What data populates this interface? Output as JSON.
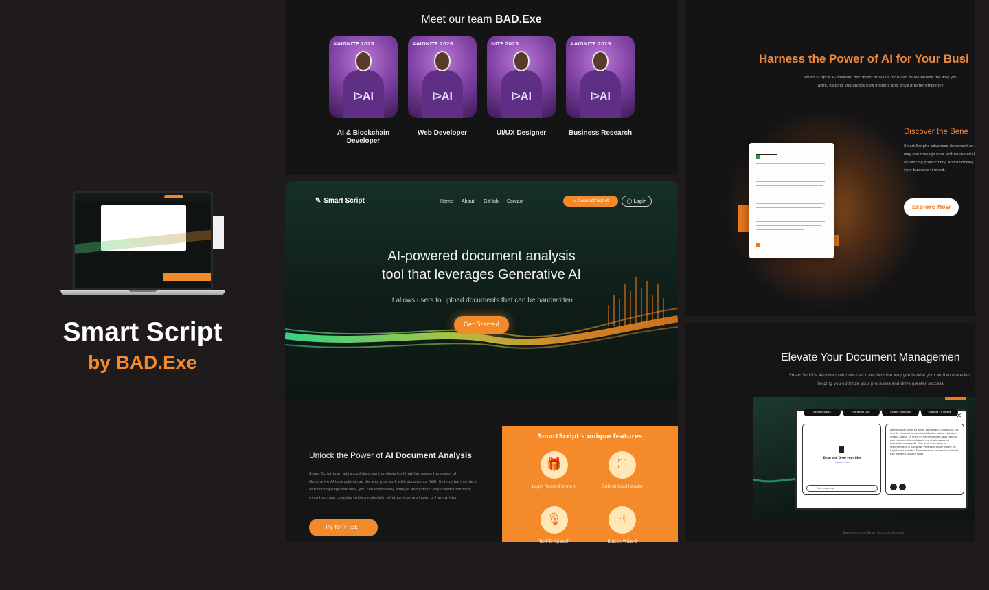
{
  "brand": {
    "title": "Smart Script",
    "by_prefix": "by ",
    "by_name": "BAD.Exe"
  },
  "team": {
    "heading_prefix": "Meet our team ",
    "heading_bold": "BAD.Exe",
    "members": [
      {
        "role": "AI & Blockchain Developer",
        "shirt_text": "I>AI",
        "tag": "#AIGNITE 2025"
      },
      {
        "role": "Web Developer",
        "shirt_text": "I>AI",
        "tag": "#AIGNITE 2025"
      },
      {
        "role": "UI/UX Designer",
        "shirt_text": "I>AI",
        "tag": "NITE 2025"
      },
      {
        "role": "Business Research",
        "shirt_text": "I>AI",
        "tag": "#AIGNITE 2025"
      }
    ]
  },
  "hero": {
    "logo": "Smart Script",
    "nav": [
      "Home",
      "About",
      "GitHub",
      "Contact"
    ],
    "connect_wallet": "Connect Wallet",
    "login": "Login",
    "title_line1": "AI-powered document analysis",
    "title_line2": "tool that leverages Generative AI",
    "subtitle": "It allows users to upload documents that can be handwritten",
    "cta": "Get Started"
  },
  "unlock": {
    "heading_prefix": "Unlock the Power of ",
    "heading_bold": "AI Document Analysis",
    "paragraph": "Smart Script is an advanced document analysis tool that harnesses the power of Generative AI to revolutionize the way you work with documents. With its intuitive interface and cutting-edge features, you can effortlessly analyze and extract key information from even the most complex written materials, whether they are typed or handwritten",
    "cta": "Try for FREE !",
    "features_heading_bold": "SmartScript",
    "features_heading_rest": "'s unique features",
    "features": [
      {
        "label": "Login Reward System",
        "icon": "gift-icon"
      },
      {
        "label": "Optical Card Reader",
        "icon": "scan-icon"
      },
      {
        "label": "Text-To-Speech",
        "icon": "speech-icon"
      },
      {
        "label": "Button Wizard",
        "icon": "pointer-icon"
      }
    ]
  },
  "harness": {
    "heading": "Harness the Power of AI for Your Busi",
    "paragraph": "Smart Script's AI-powered document analysis tools can revolutionize the way you work, helping you unlock new insights and drive greater efficiency",
    "discover_heading": "Discover the Bene",
    "discover_paragraph": "Smart Script's advanced document an... way you manage your written material enhancing productivity, and unlocking your business forward.",
    "cta": "Explore Now"
  },
  "elevate": {
    "heading": "Elevate Your Document Managemen",
    "paragraph": "Smart Script's AI-driven solutions can transform the way you handle your written materials, helping you optimize your processes and drive greater success",
    "upload_title": "Drag and Drop your files",
    "upload_link": "Upload files",
    "prompt_placeholder": "Enter a prompt",
    "result_text": "Lorem ipsum dolor sit amet, consectetur adipiscing elit. Sed do eiusmod tempor incididunt ut labore et dolore magna aliqua. Ut enim ad minim veniam, quis nostrud exercitation ullamco laboris nisi ut aliquip ex ea commodo consequat. Duis aute irure dolor in reprehenderit in voluptate velit esse cillum dolore eu fugiat nulla pariatur. Excepteur sint occaecat cupidatat non proident, sunt in culpa",
    "buttons": [
      "Explore Topics",
      "Generate Que",
      "Collect Formulas",
      "Suggest YT Videos"
    ],
    "footer": "Experience the Smart Script Advantage"
  },
  "colors": {
    "accent": "#f08a2a",
    "background": "#1f1b1c"
  }
}
